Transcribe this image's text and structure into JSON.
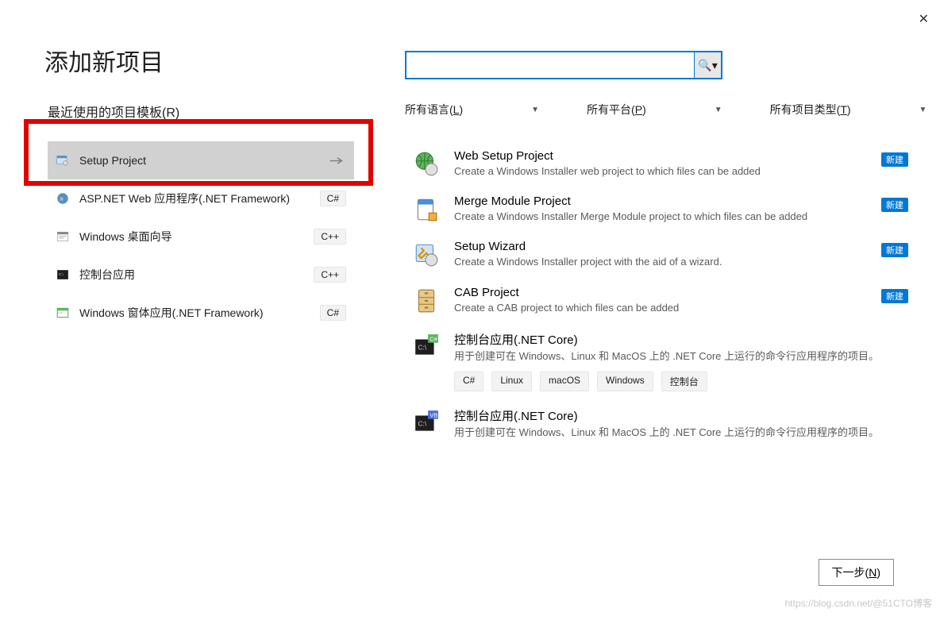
{
  "close_glyph": "✕",
  "dialog_title": "添加新项目",
  "recent_section": "最近使用的项目模板(R)",
  "recent": [
    {
      "label": "Setup Project",
      "badge": null,
      "selected": true,
      "pin": true
    },
    {
      "label": "ASP.NET Web 应用程序(.NET Framework)",
      "badge": "C#",
      "selected": false,
      "pin": false
    },
    {
      "label": "Windows 桌面向导",
      "badge": "C++",
      "selected": false,
      "pin": false
    },
    {
      "label": "控制台应用",
      "badge": "C++",
      "selected": false,
      "pin": false
    },
    {
      "label": "Windows 窗体应用(.NET Framework)",
      "badge": "C#",
      "selected": false,
      "pin": false
    }
  ],
  "search": {
    "button_glyph": "🔍▾"
  },
  "filters": {
    "language": {
      "prefix": "所有语言(",
      "u": "L",
      "suffix": ")"
    },
    "platform": {
      "prefix": "所有平台(",
      "u": "P",
      "suffix": ")"
    },
    "type": {
      "prefix": "所有项目类型(",
      "u": "T",
      "suffix": ")"
    }
  },
  "templates": [
    {
      "title": "Web Setup Project",
      "desc": "Create a Windows Installer web project to which files can be added",
      "new": true,
      "tags": [],
      "icon": "globe-disc"
    },
    {
      "title": "Merge Module Project",
      "desc": "Create a Windows Installer Merge Module project to which files can be added",
      "new": true,
      "tags": [],
      "icon": "merge"
    },
    {
      "title": "Setup Wizard",
      "desc": "Create a Windows Installer project with the aid of a wizard.",
      "new": true,
      "tags": [],
      "icon": "wizard-disc"
    },
    {
      "title": "CAB Project",
      "desc": "Create a CAB project to which files can be added",
      "new": true,
      "tags": [],
      "icon": "cabinet"
    },
    {
      "title": "控制台应用(.NET Core)",
      "desc": "用于创建可在 Windows、Linux 和 MacOS 上的 .NET Core 上运行的命令行应用程序的项目。",
      "new": false,
      "tags": [
        "C#",
        "Linux",
        "macOS",
        "Windows",
        "控制台"
      ],
      "icon": "console-cs"
    },
    {
      "title": "控制台应用(.NET Core)",
      "desc": "用于创建可在 Windows、Linux 和 MacOS 上的 .NET Core 上运行的命令行应用程序的项目。",
      "new": false,
      "tags": [],
      "icon": "console-vb"
    }
  ],
  "new_badge_text": "新建",
  "next_button": {
    "prefix": "下一步(",
    "u": "N",
    "suffix": ")"
  },
  "watermark": "https://blog.csdn.net/@51CTO博客"
}
